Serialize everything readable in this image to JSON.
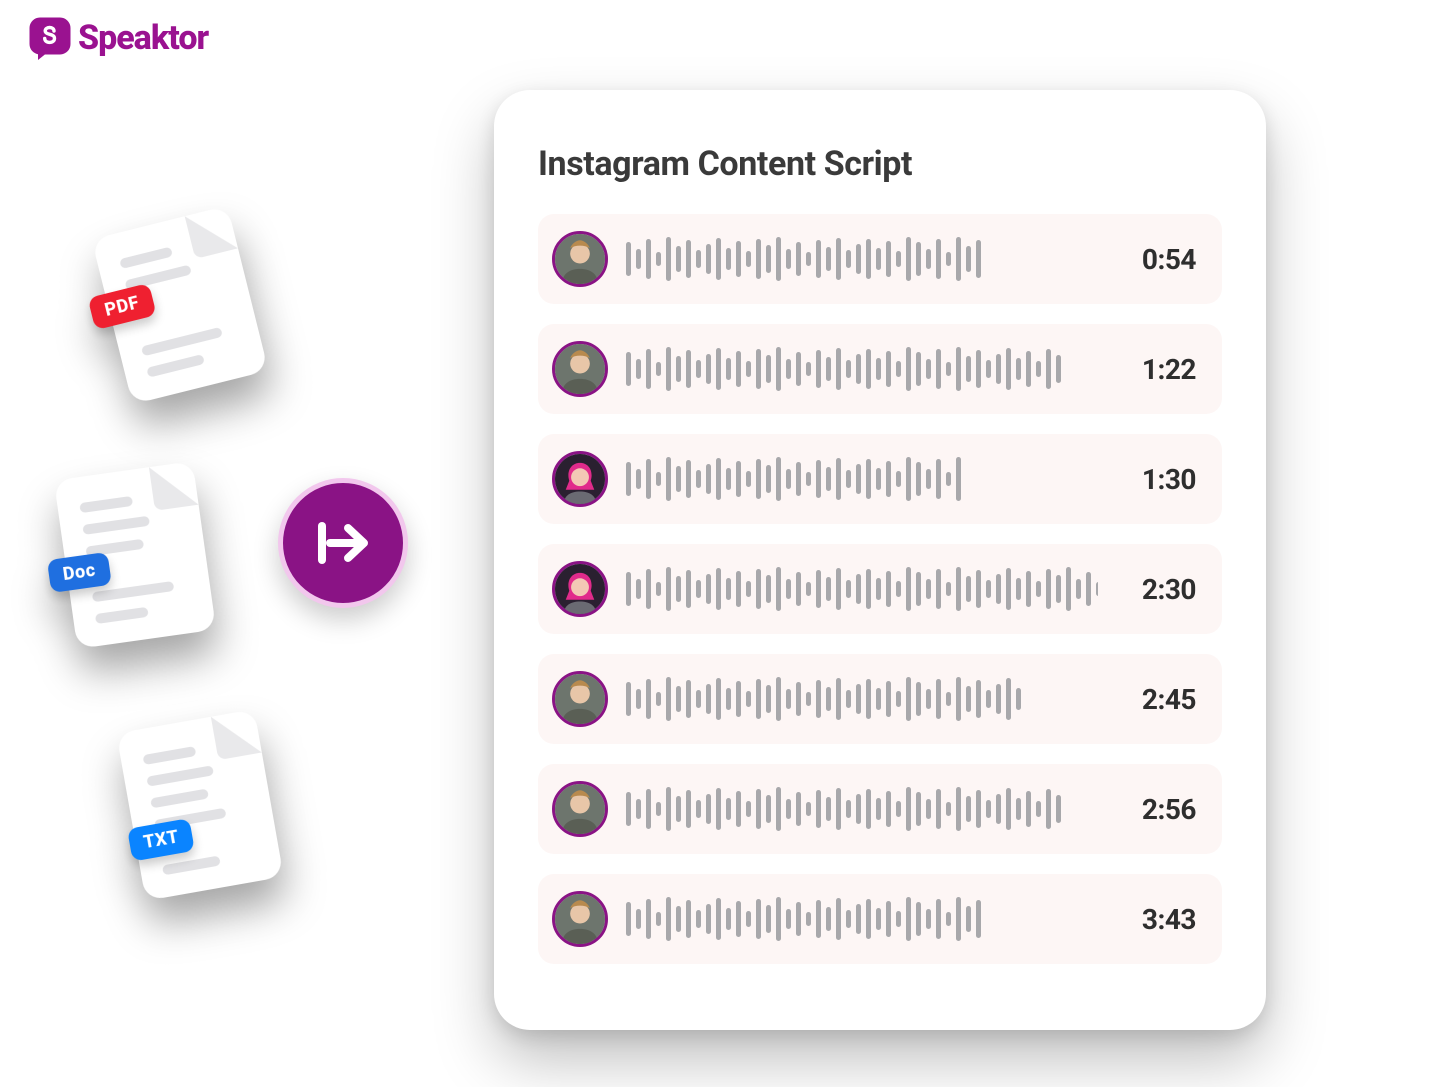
{
  "brand": {
    "name": "Speaktor",
    "accent_color": "#9a1290"
  },
  "input_files": [
    {
      "label": "PDF",
      "badge_color": "#ef2030"
    },
    {
      "label": "Doc",
      "badge_color": "#1f6fe0"
    },
    {
      "label": "TXT",
      "badge_color": "#0a84ff"
    }
  ],
  "convert_action": {
    "icon": "arrow-right-to-line"
  },
  "panel": {
    "title": "Instagram Content Script",
    "tracks": [
      {
        "speaker": "male-1",
        "duration": "0:54",
        "wave_len": 36
      },
      {
        "speaker": "male-1",
        "duration": "1:22",
        "wave_len": 44
      },
      {
        "speaker": "female-1",
        "duration": "1:30",
        "wave_len": 34
      },
      {
        "speaker": "female-1",
        "duration": "2:30",
        "wave_len": 54
      },
      {
        "speaker": "male-1",
        "duration": "2:45",
        "wave_len": 40
      },
      {
        "speaker": "male-1",
        "duration": "2:56",
        "wave_len": 44
      },
      {
        "speaker": "male-1",
        "duration": "3:43",
        "wave_len": 36
      }
    ]
  }
}
